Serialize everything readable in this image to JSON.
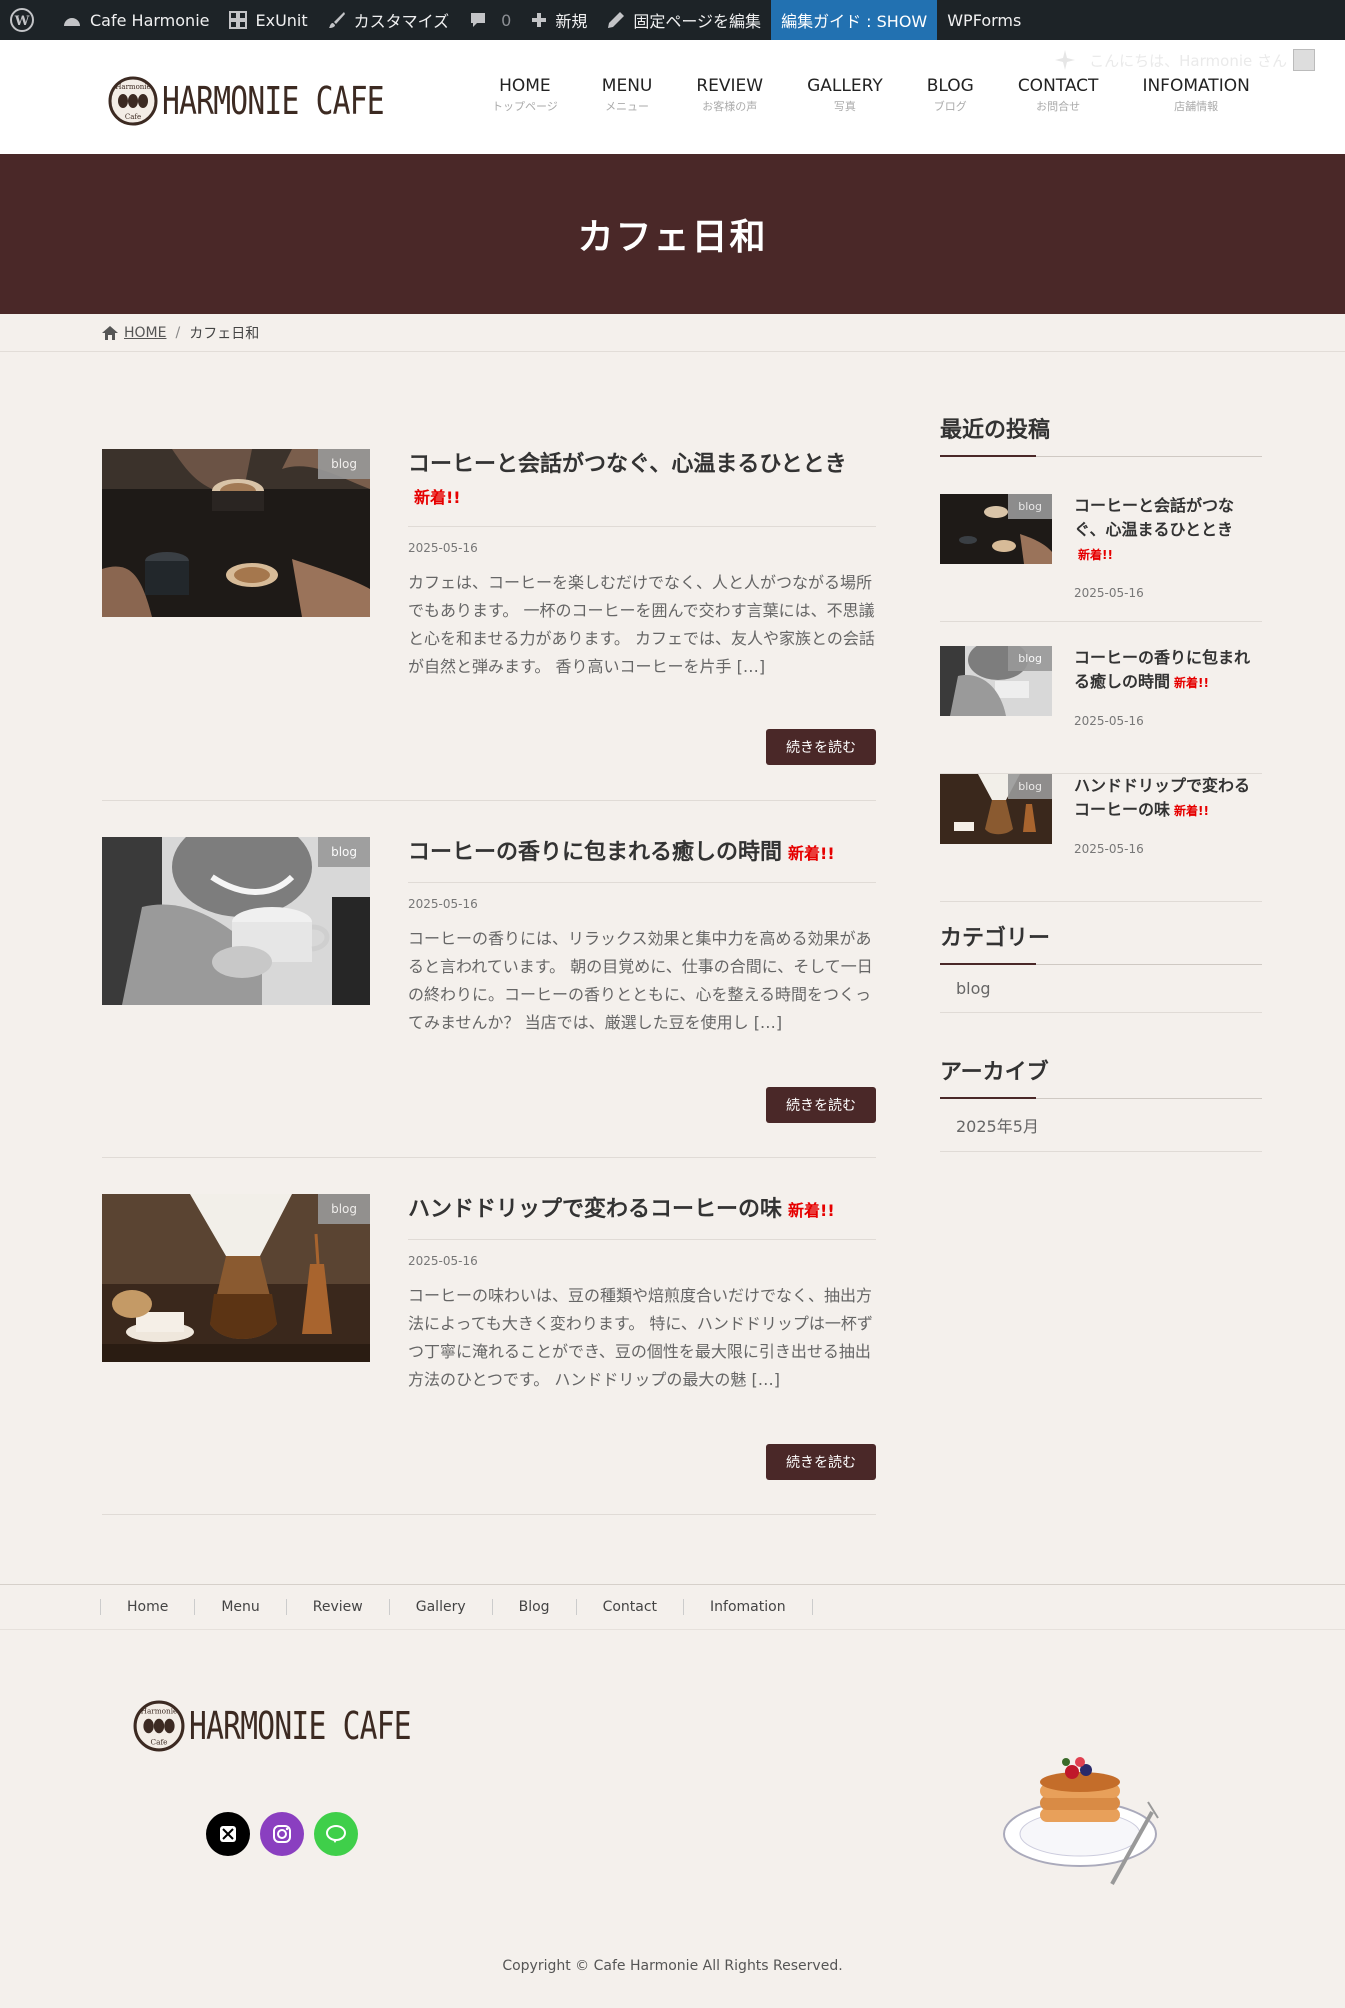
{
  "adminbar": {
    "site": "Cafe Harmonie",
    "exunit": "ExUnit",
    "customize": "カスタマイズ",
    "comments_count": "0",
    "new": "新規",
    "edit_page": "固定ページを編集",
    "guide": "編集ガイド : SHOW",
    "wpforms": "WPForms",
    "greeting": "こんにちは、Harmonie さん"
  },
  "logo": {
    "text": "HARMONIE CAFE",
    "badge_top": "Harmonie",
    "badge_bottom": "Cafe"
  },
  "nav": [
    {
      "main": "HOME",
      "sub": "トップページ"
    },
    {
      "main": "MENU",
      "sub": "メニュー"
    },
    {
      "main": "REVIEW",
      "sub": "お客様の声"
    },
    {
      "main": "GALLERY",
      "sub": "写真"
    },
    {
      "main": "BLOG",
      "sub": "ブログ"
    },
    {
      "main": "CONTACT",
      "sub": "お問合せ"
    },
    {
      "main": "INFOMATION",
      "sub": "店舗情報"
    }
  ],
  "hero": {
    "title": "カフェ日和"
  },
  "breadcrumb": {
    "home": "HOME",
    "current": "カフェ日和"
  },
  "posts": [
    {
      "category": "blog",
      "title": "コーヒーと会話がつなぐ、心温まるひととき",
      "badge": "新着!!",
      "date": "2025-05-16",
      "excerpt": "カフェは、コーヒーを楽しむだけでなく、人と人がつながる場所でもあります。 一杯のコーヒーを囲んで交わす言葉には、不思議と心を和ませる力があります。 カフェでは、友人や家族との会話が自然と弾みます。 香り高いコーヒーを片手 […]",
      "more": "続きを読む"
    },
    {
      "category": "blog",
      "title": "コーヒーの香りに包まれる癒しの時間",
      "badge": "新着!!",
      "date": "2025-05-16",
      "excerpt": "コーヒーの香りには、リラックス効果と集中力を高める効果があると言われています。 朝の目覚めに、仕事の合間に、そして一日の終わりに。コーヒーの香りとともに、心を整える時間をつくってみませんか？ 当店では、厳選した豆を使用し […]",
      "more": "続きを読む"
    },
    {
      "category": "blog",
      "title": "ハンドドリップで変わるコーヒーの味",
      "badge": "新着!!",
      "date": "2025-05-16",
      "excerpt": "コーヒーの味わいは、豆の種類や焙煎度合いだけでなく、抽出方法によっても大きく変わります。 特に、ハンドドリップは一杯ずつ丁寧に淹れることができ、豆の個性を最大限に引き出せる抽出方法のひとつです。 ハンドドリップの最大の魅 […]",
      "more": "続きを読む"
    }
  ],
  "sidebar": {
    "recent_title": "最近の投稿",
    "recent": [
      {
        "category": "blog",
        "title": "コーヒーと会話がつなぐ、心温まるひととき",
        "badge": "新着!!",
        "date": "2025-05-16"
      },
      {
        "category": "blog",
        "title": "コーヒーの香りに包まれる癒しの時間",
        "badge": "新着!!",
        "date": "2025-05-16"
      },
      {
        "category": "blog",
        "title": "ハンドドリップで変わるコーヒーの味",
        "badge": "新着!!",
        "date": "2025-05-16"
      }
    ],
    "category_title": "カテゴリー",
    "category_item": "blog",
    "archive_title": "アーカイブ",
    "archive_item": "2025年5月"
  },
  "footer": {
    "nav": [
      "Home",
      "Menu",
      "Review",
      "Gallery",
      "Blog",
      "Contact",
      "Infomation"
    ],
    "copyright": "Copyright © Cafe Harmonie All Rights Reserved."
  },
  "colors": {
    "brand": "#4a2828",
    "new_badge": "#e60000",
    "adminbar": "#1d2327",
    "guide": "#2271b1"
  }
}
